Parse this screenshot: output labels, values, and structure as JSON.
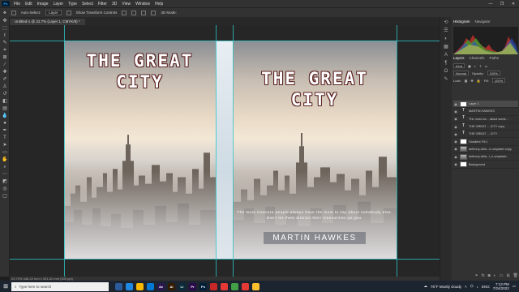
{
  "app": {
    "logo": "Ps",
    "menu": [
      "File",
      "Edit",
      "Image",
      "Layer",
      "Type",
      "Select",
      "Filter",
      "3D",
      "View",
      "Window",
      "Help"
    ],
    "window_controls": [
      "—",
      "❐",
      "✕"
    ]
  },
  "options_bar": {
    "auto_select_label": "Auto-Select:",
    "auto_select_value": "Layer",
    "show_transform_controls": "Show Transform Controls",
    "mode_3d": "3D Mode:"
  },
  "document": {
    "tab_title": "Untitled-1 @ 22.7% (Layer 1, CMYK/8) *",
    "status": "22.73%   446.22 mm x 301.61 mm (300 ppi)"
  },
  "cover_left": {
    "title_line1": "THE GREAT",
    "title_line2": "CITY"
  },
  "cover_right": {
    "title_line1": "THE GREAT",
    "title_line2": "CITY",
    "tagline_line1": "The most insecure people always have the most to say about somebody else.",
    "tagline_line2": "Don't let them distract their insecurities on you.",
    "author": "MARTIN HAWKES"
  },
  "panels": {
    "top_tabs": [
      "Histogram",
      "Navigator"
    ],
    "layer_tabs": [
      "Layers",
      "Channels",
      "Paths"
    ],
    "kind_label": "Kind",
    "blend_mode": "Normal",
    "opacity_label": "Opacity:",
    "opacity_value": "100%",
    "lock_label": "Lock:",
    "fill_label": "Fill:",
    "fill_value": "100%",
    "layers": [
      {
        "name": "Layer 1",
        "type": "pixel",
        "selected": true
      },
      {
        "name": "MARTIN HAWKES",
        "type": "text",
        "selected": false
      },
      {
        "name": "The most inc... about some...",
        "type": "text",
        "selected": false
      },
      {
        "name": "THE GREAT ... CITY copy",
        "type": "text",
        "selected": false
      },
      {
        "name": "THE GREAT ... CITY",
        "type": "text",
        "selected": false
      },
      {
        "name": "Gradient Fill 1",
        "type": "fill",
        "selected": false
      },
      {
        "name": "anthony-dela...n-unsplash copy",
        "type": "image",
        "selected": false
      },
      {
        "name": "anthony-dela...l_n-unsplash",
        "type": "image",
        "selected": false
      },
      {
        "name": "Background",
        "type": "pixel",
        "selected": false
      }
    ]
  },
  "taskbar": {
    "search_placeholder": "Type here to search",
    "apps": [
      {
        "label": "",
        "color": "#2a5a9a"
      },
      {
        "label": "",
        "color": "#1e88e5"
      },
      {
        "label": "",
        "color": "#f6b800"
      },
      {
        "label": "",
        "color": "#0078d4"
      },
      {
        "label": "Ae",
        "color": "#2a1650"
      },
      {
        "label": "Ai",
        "color": "#331c00"
      },
      {
        "label": "Lr",
        "color": "#0b2a3a"
      },
      {
        "label": "Pr",
        "color": "#2a0a4a"
      },
      {
        "label": "Ps",
        "color": "#001e36"
      },
      {
        "label": "",
        "color": "#c62828"
      },
      {
        "label": "",
        "color": "#e53935"
      },
      {
        "label": "",
        "color": "#43a047"
      },
      {
        "label": "",
        "color": "#e53935"
      },
      {
        "label": "",
        "color": "#fbc02d"
      }
    ],
    "weather": "76°F  Mostly cloudy",
    "language": "ENG",
    "time": "7:13 PM",
    "date": "7/24/2022"
  }
}
